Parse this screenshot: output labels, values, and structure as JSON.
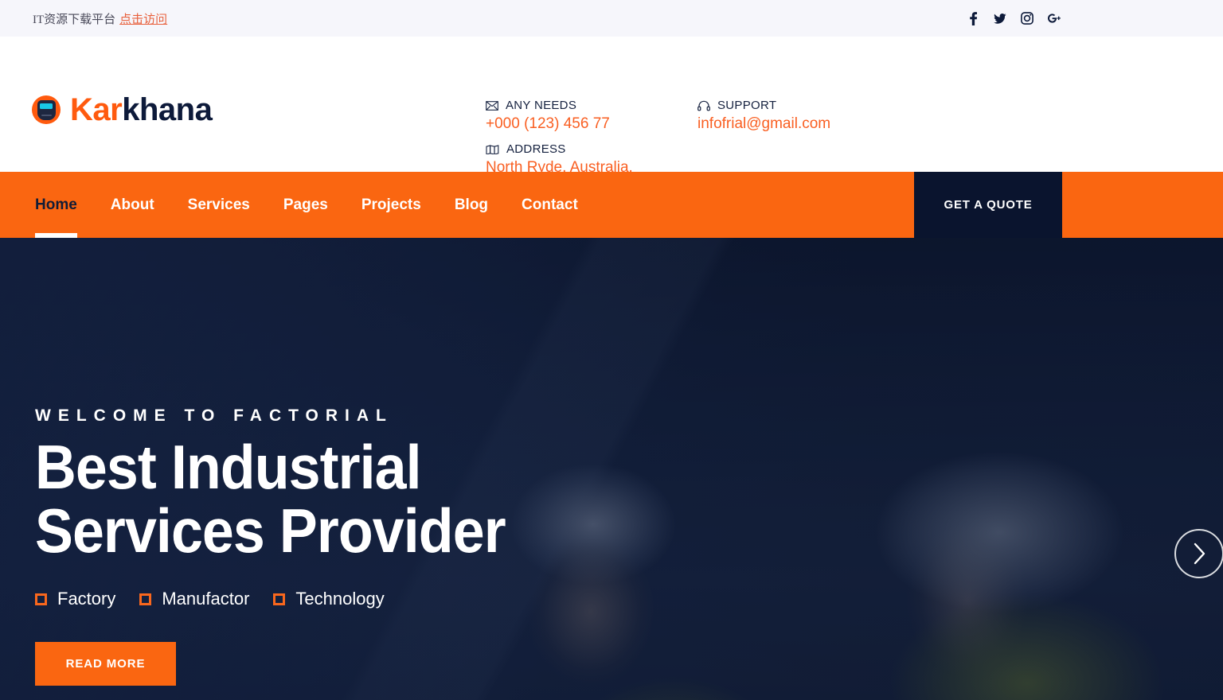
{
  "topbar": {
    "notice_text": "IT资源下载平台",
    "notice_link": "点击访问",
    "social": [
      {
        "name": "facebook-icon",
        "label": "f"
      },
      {
        "name": "twitter-icon",
        "label": "t"
      },
      {
        "name": "instagram-icon",
        "label": "i"
      },
      {
        "name": "googleplus-icon",
        "label": "g+"
      }
    ]
  },
  "brand": {
    "name_first": "Kar",
    "name_second": "khana",
    "icon": "welding-helmet-icon"
  },
  "contacts": {
    "any_needs_label": "ANY NEEDS",
    "phone": "+000 (123) 456 77",
    "address_label": "ADDRESS",
    "address": "North Ryde, Australia.",
    "support_label": "SUPPORT",
    "email": "infofrial@gmail.com"
  },
  "nav": {
    "items": [
      {
        "label": "Home",
        "active": true
      },
      {
        "label": "About",
        "active": false
      },
      {
        "label": "Services",
        "active": false
      },
      {
        "label": "Pages",
        "active": false
      },
      {
        "label": "Projects",
        "active": false
      },
      {
        "label": "Blog",
        "active": false
      },
      {
        "label": "Contact",
        "active": false
      }
    ],
    "quote_label": "GET A QUOTE"
  },
  "hero": {
    "eyebrow": "WELCOME TO FACTORIAL",
    "title_line1": "Best Industrial",
    "title_line2": "Services Provider",
    "features": [
      "Factory",
      "Manufactor",
      "Technology"
    ],
    "cta_label": "READ MORE",
    "next_arrow": "chevron-right-icon"
  },
  "colors": {
    "accent_orange": "#fa6611",
    "dark_navy": "#0a142e",
    "topbar_bg": "#f6f6fb",
    "link_orange": "#e8603c",
    "contact_orange": "#f95f22"
  }
}
